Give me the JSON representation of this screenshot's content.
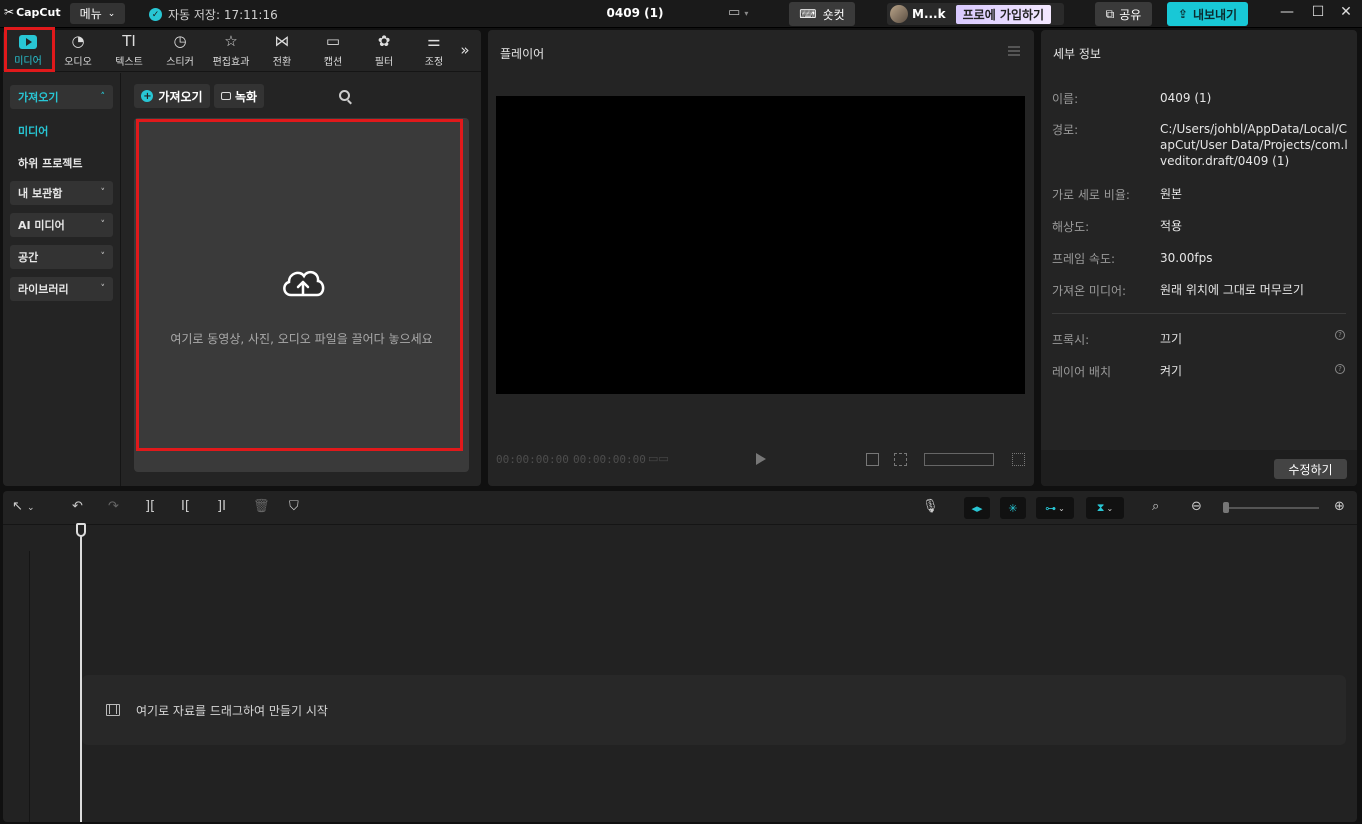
{
  "titlebar": {
    "logo": "CapCut",
    "menu_label": "메뉴",
    "autosave_text": "자동 저장: 17:11:16",
    "project_title": "0409 (1)",
    "shortcut_label": "숏컷",
    "username": "M...k",
    "pro_label": "프로에 가입하기",
    "share_label": "공유",
    "export_label": "내보내기"
  },
  "tools": {
    "media": "미디어",
    "audio": "오디오",
    "text": "텍스트",
    "sticker": "스티커",
    "effects": "편집효과",
    "transition": "전환",
    "caption": "캡션",
    "filter": "필터",
    "adjust": "조정"
  },
  "subnav": {
    "import_group": "가져오기",
    "media_item": "미디어",
    "subproject_item": "하위 프로젝트",
    "my_storage": "내 보관함",
    "ai_media": "AI 미디어",
    "space": "공간",
    "library": "라이브러리"
  },
  "media": {
    "import_chip": "가져오기",
    "record_chip": "녹화",
    "drop_text": "여기로 동영상, 사진, 오디오 파일을 끌어다 놓으세요"
  },
  "player": {
    "title": "플레이어",
    "current_time": "00:00:00:00",
    "total_time": "00:00:00:00"
  },
  "details": {
    "title": "세부 정보",
    "name_label": "이름:",
    "name_value": "0409 (1)",
    "path_label": "경로:",
    "path_value": "C:/Users/johbl/AppData/Local/CapCut/User Data/Projects/com.lveditor.draft/0409 (1)",
    "ratio_label": "가로 세로 비율:",
    "ratio_value": "원본",
    "resolution_label": "해상도:",
    "resolution_value": "적용",
    "framerate_label": "프레임 속도:",
    "framerate_value": "30.00fps",
    "imported_label": "가져온 미디어:",
    "imported_value": "원래 위치에 그대로 머무르기",
    "proxy_label": "프록시:",
    "proxy_value": "끄기",
    "layer_label": "레이어 배치",
    "layer_value": "켜기",
    "modify_label": "수정하기"
  },
  "timeline": {
    "drop_text": "여기로 자료를 드래그하여 만들기 시작"
  },
  "colors": {
    "accent": "#28c6d4",
    "highlight_box": "#e0191b"
  }
}
